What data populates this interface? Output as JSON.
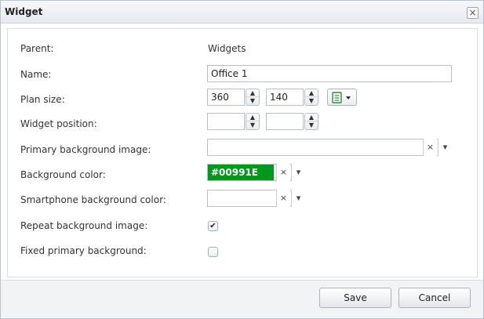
{
  "window": {
    "title": "Widget",
    "close_glyph": "×"
  },
  "form": {
    "parent": {
      "label": "Parent:",
      "value": "Widgets"
    },
    "name": {
      "label": "Name:",
      "value": "Office 1"
    },
    "plan_size": {
      "label": "Plan size:",
      "width": "360",
      "height": "140"
    },
    "widget_position": {
      "label": "Widget position:",
      "x": "",
      "y": ""
    },
    "primary_bg_image": {
      "label": "Primary background image:",
      "value": ""
    },
    "background_color": {
      "label": "Background color:",
      "value": "#00991E",
      "color": "#00991E"
    },
    "smartphone_bg_color": {
      "label": "Smartphone background color:",
      "value": ""
    },
    "repeat_bg_image": {
      "label": "Repeat background image:",
      "checked": true,
      "mark": "✔"
    },
    "fixed_primary_bg": {
      "label": "Fixed primary background:",
      "checked": false
    }
  },
  "icons": {
    "spin_up": "▲",
    "spin_down": "▼",
    "clear": "×",
    "dropdown": "▾"
  },
  "buttons": {
    "save": "Save",
    "cancel": "Cancel"
  }
}
